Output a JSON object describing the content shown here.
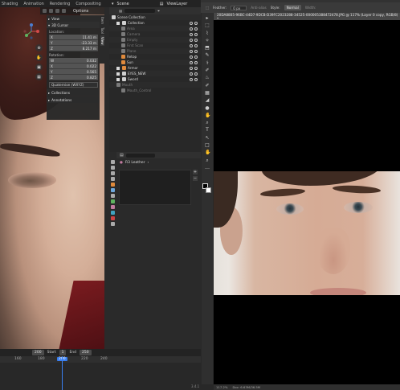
{
  "blender": {
    "menu": [
      "Shading",
      "Animation",
      "Rendering",
      "Compositing"
    ],
    "scene_label": "Scene",
    "view_layer": "ViewLayer",
    "viewport": {
      "options_label": "Options",
      "npanel": {
        "view_label": "View",
        "cursor_label": "3D Cursor",
        "location_label": "Location:",
        "location": [
          {
            "axis": "X",
            "value": "11.41 m"
          },
          {
            "axis": "Y",
            "value": "-23.33 m"
          },
          {
            "axis": "Z",
            "value": "8.217 m"
          }
        ],
        "rotation_label": "Rotation:",
        "rotation": [
          {
            "axis": "W",
            "value": "0.032"
          },
          {
            "axis": "X",
            "value": "0.022"
          },
          {
            "axis": "Y",
            "value": "0.565"
          },
          {
            "axis": "Z",
            "value": "0.825"
          }
        ],
        "rotation_mode": "Quaternion (WXYZ)",
        "collections_label": "Collections",
        "annotations_label": "Annotations"
      },
      "side_tabs": [
        "Item",
        "Tool",
        "View"
      ]
    },
    "timeline": {
      "current_frame": "200",
      "start_label": "Start",
      "start": "1",
      "end_label": "End",
      "end": "250",
      "ruler": [
        "160",
        "180",
        "200",
        "220",
        "240"
      ]
    },
    "outliner": {
      "rows": [
        {
          "name": "Scene Collection",
          "depth": 0,
          "color": "#cfcfcf",
          "vis": false,
          "dim": false,
          "check": false
        },
        {
          "name": "Collection",
          "depth": 1,
          "color": "#cfcfcf",
          "vis": true,
          "dim": false,
          "check": true
        },
        {
          "name": "Area",
          "depth": 2,
          "color": "#7a7a7a",
          "vis": true,
          "dim": true,
          "check": false
        },
        {
          "name": "Camera",
          "depth": 2,
          "color": "#7a7a7a",
          "vis": true,
          "dim": true,
          "check": false
        },
        {
          "name": "Empty",
          "depth": 2,
          "color": "#7a7a7a",
          "vis": true,
          "dim": true,
          "check": false
        },
        {
          "name": "First Scan",
          "depth": 2,
          "color": "#7a7a7a",
          "vis": true,
          "dim": true,
          "check": false
        },
        {
          "name": "Plane",
          "depth": 2,
          "color": "#7a7a7a",
          "vis": true,
          "dim": true,
          "check": false
        },
        {
          "name": "Retop",
          "depth": 2,
          "color": "#e08a3c",
          "vis": true,
          "dim": false,
          "check": false
        },
        {
          "name": "Sun",
          "depth": 2,
          "color": "#e08a3c",
          "vis": true,
          "dim": false,
          "check": false
        },
        {
          "name": "Armor",
          "depth": 1,
          "color": "#e08a3c",
          "vis": true,
          "dim": false,
          "check": true
        },
        {
          "name": "EYES_NEW",
          "depth": 1,
          "color": "#cfcfcf",
          "vis": true,
          "dim": false,
          "check": true
        },
        {
          "name": "Sword",
          "depth": 1,
          "color": "#cfcfcf",
          "vis": true,
          "dim": false,
          "check": true
        },
        {
          "name": "Mouth",
          "depth": 1,
          "color": "#7a7a7a",
          "vis": false,
          "dim": true,
          "check": false
        },
        {
          "name": "Mouth_Control",
          "depth": 2,
          "color": "#7a7a7a",
          "vis": false,
          "dim": true,
          "check": false
        }
      ]
    },
    "properties": {
      "material_name": "R3 Leather",
      "tab_colors": [
        "#aaaaaa",
        "#aaaaaa",
        "#aaaaaa",
        "#aaaaaa",
        "#e08a3c",
        "#6fa8dc",
        "#aaaaaa",
        "#5fb35f",
        "#c27ba0",
        "#3fa3c0",
        "#cc4444",
        "#aaaaaa"
      ]
    },
    "version": "3.4.1"
  },
  "photoshop": {
    "options": {
      "feather_label": "Feather:",
      "feather_value": "0 px",
      "antialias_label": "Anti-alias",
      "style_label": "Style:",
      "style_value": "Normal",
      "width_label": "Width:"
    },
    "doc_tab": "20DA8805-96BC-44D7-9DCB-D39FC2023288-34525-000005388472478.JPG @ 117% (Layer 0 copy, RGB/8) *",
    "tools": [
      "▸",
      "⬚",
      "⌇",
      "✧",
      "⬒",
      "✎",
      "⚕",
      "✐",
      "♨",
      "✐",
      "▦",
      "◢",
      "●",
      "✋",
      "⌕",
      "T",
      "↖",
      "□",
      "✋",
      "⌕",
      "…"
    ],
    "status_zoom": "117.2%",
    "status_doc": "Doc: 6.63M/36.5M"
  }
}
